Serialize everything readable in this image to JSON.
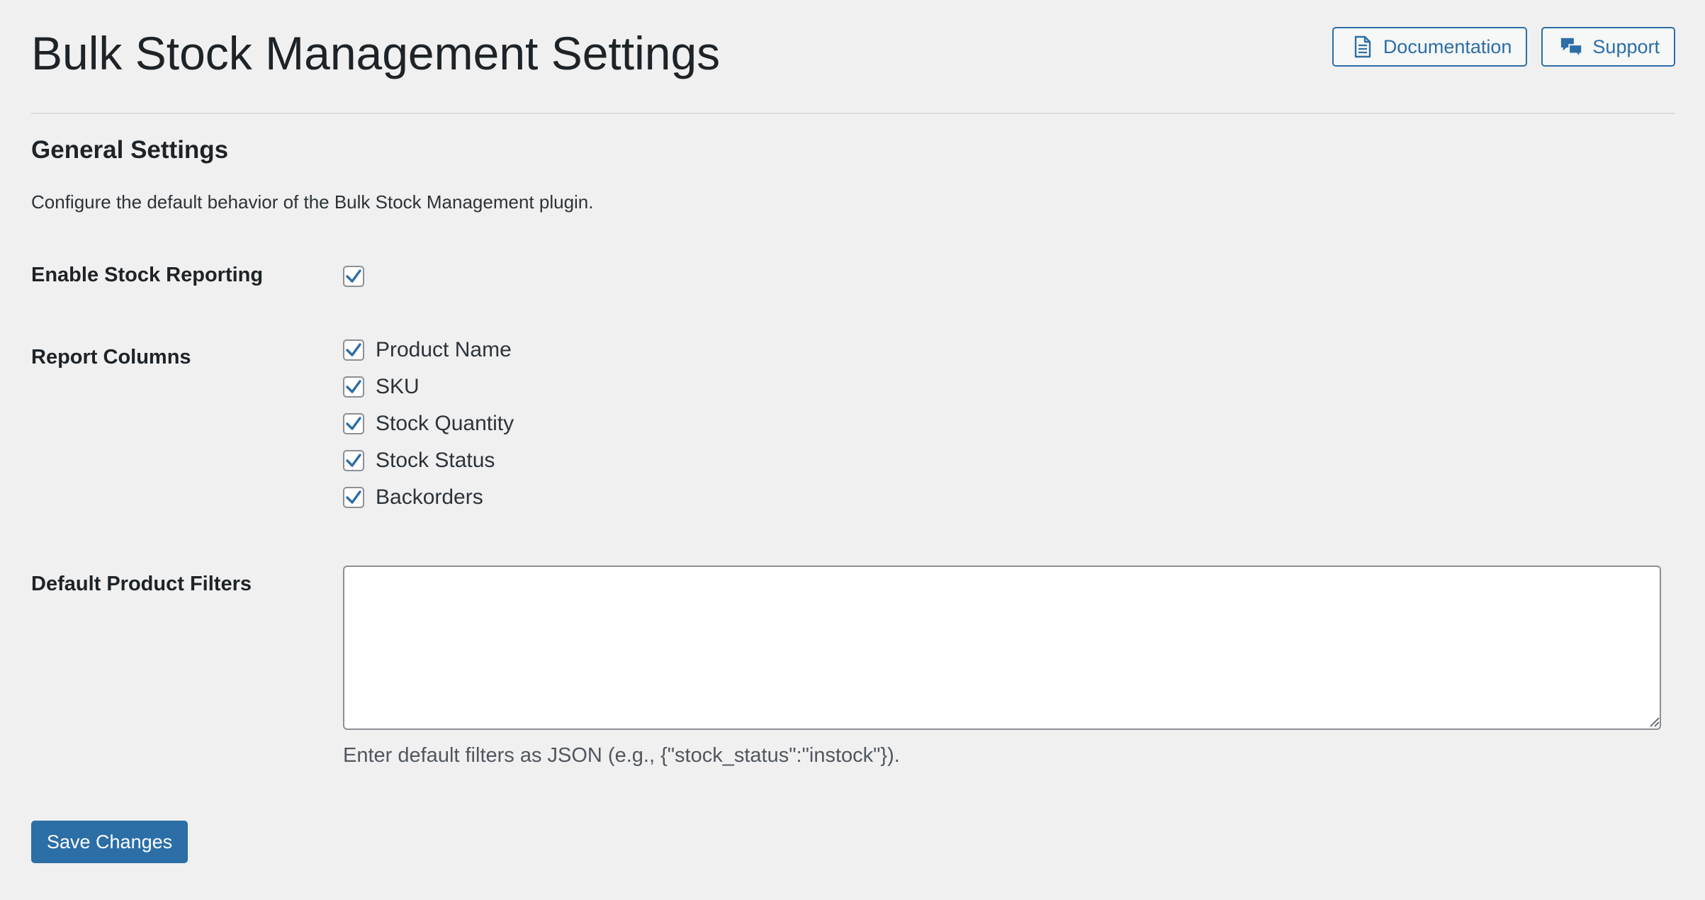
{
  "header": {
    "title": "Bulk Stock Management Settings",
    "documentation_label": "Documentation",
    "documentation_icon": "document-icon",
    "support_label": "Support",
    "support_icon": "speech-bubbles-icon"
  },
  "section": {
    "title": "General Settings",
    "description": "Configure the default behavior of the Bulk Stock Management plugin."
  },
  "fields": {
    "enable_reporting": {
      "label": "Enable Stock Reporting",
      "checked": true
    },
    "report_columns": {
      "label": "Report Columns",
      "options": [
        {
          "label": "Product Name",
          "checked": true
        },
        {
          "label": "SKU",
          "checked": true
        },
        {
          "label": "Stock Quantity",
          "checked": true
        },
        {
          "label": "Stock Status",
          "checked": true
        },
        {
          "label": "Backorders",
          "checked": true
        }
      ]
    },
    "default_filters": {
      "label": "Default Product Filters",
      "value": "",
      "help": "Enter default filters as JSON (e.g., {\"stock_status\":\"instock\"})."
    }
  },
  "actions": {
    "save_label": "Save Changes"
  },
  "colors": {
    "accent": "#2c6ea6",
    "background": "#f0f0f1",
    "text": "#1d2327"
  }
}
